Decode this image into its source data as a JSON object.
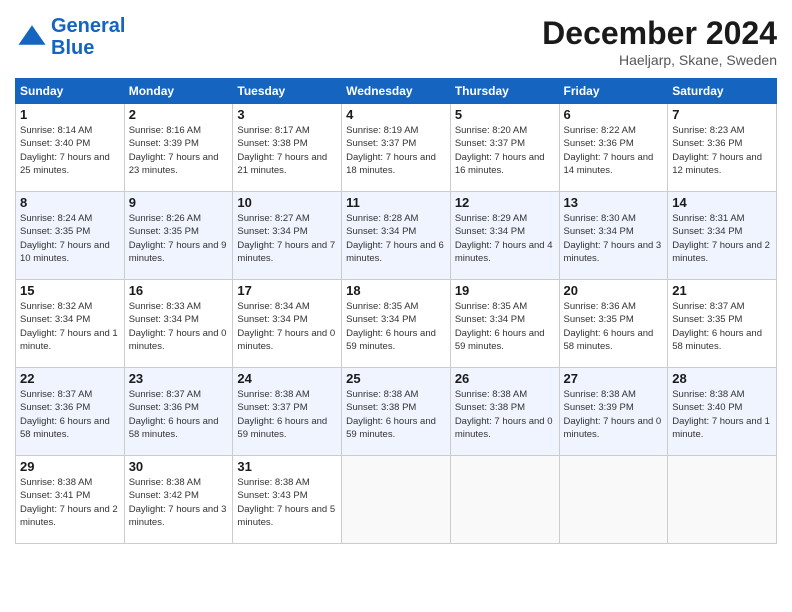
{
  "logo": {
    "line1": "General",
    "line2": "Blue"
  },
  "header": {
    "title": "December 2024",
    "location": "Haeljarp, Skane, Sweden"
  },
  "weekdays": [
    "Sunday",
    "Monday",
    "Tuesday",
    "Wednesday",
    "Thursday",
    "Friday",
    "Saturday"
  ],
  "weeks": [
    [
      {
        "day": "1",
        "sunrise": "8:14 AM",
        "sunset": "3:40 PM",
        "daylight": "7 hours and 25 minutes."
      },
      {
        "day": "2",
        "sunrise": "8:16 AM",
        "sunset": "3:39 PM",
        "daylight": "7 hours and 23 minutes."
      },
      {
        "day": "3",
        "sunrise": "8:17 AM",
        "sunset": "3:38 PM",
        "daylight": "7 hours and 21 minutes."
      },
      {
        "day": "4",
        "sunrise": "8:19 AM",
        "sunset": "3:37 PM",
        "daylight": "7 hours and 18 minutes."
      },
      {
        "day": "5",
        "sunrise": "8:20 AM",
        "sunset": "3:37 PM",
        "daylight": "7 hours and 16 minutes."
      },
      {
        "day": "6",
        "sunrise": "8:22 AM",
        "sunset": "3:36 PM",
        "daylight": "7 hours and 14 minutes."
      },
      {
        "day": "7",
        "sunrise": "8:23 AM",
        "sunset": "3:36 PM",
        "daylight": "7 hours and 12 minutes."
      }
    ],
    [
      {
        "day": "8",
        "sunrise": "8:24 AM",
        "sunset": "3:35 PM",
        "daylight": "7 hours and 10 minutes."
      },
      {
        "day": "9",
        "sunrise": "8:26 AM",
        "sunset": "3:35 PM",
        "daylight": "7 hours and 9 minutes."
      },
      {
        "day": "10",
        "sunrise": "8:27 AM",
        "sunset": "3:34 PM",
        "daylight": "7 hours and 7 minutes."
      },
      {
        "day": "11",
        "sunrise": "8:28 AM",
        "sunset": "3:34 PM",
        "daylight": "7 hours and 6 minutes."
      },
      {
        "day": "12",
        "sunrise": "8:29 AM",
        "sunset": "3:34 PM",
        "daylight": "7 hours and 4 minutes."
      },
      {
        "day": "13",
        "sunrise": "8:30 AM",
        "sunset": "3:34 PM",
        "daylight": "7 hours and 3 minutes."
      },
      {
        "day": "14",
        "sunrise": "8:31 AM",
        "sunset": "3:34 PM",
        "daylight": "7 hours and 2 minutes."
      }
    ],
    [
      {
        "day": "15",
        "sunrise": "8:32 AM",
        "sunset": "3:34 PM",
        "daylight": "7 hours and 1 minute."
      },
      {
        "day": "16",
        "sunrise": "8:33 AM",
        "sunset": "3:34 PM",
        "daylight": "7 hours and 0 minutes."
      },
      {
        "day": "17",
        "sunrise": "8:34 AM",
        "sunset": "3:34 PM",
        "daylight": "7 hours and 0 minutes."
      },
      {
        "day": "18",
        "sunrise": "8:35 AM",
        "sunset": "3:34 PM",
        "daylight": "6 hours and 59 minutes."
      },
      {
        "day": "19",
        "sunrise": "8:35 AM",
        "sunset": "3:34 PM",
        "daylight": "6 hours and 59 minutes."
      },
      {
        "day": "20",
        "sunrise": "8:36 AM",
        "sunset": "3:35 PM",
        "daylight": "6 hours and 58 minutes."
      },
      {
        "day": "21",
        "sunrise": "8:37 AM",
        "sunset": "3:35 PM",
        "daylight": "6 hours and 58 minutes."
      }
    ],
    [
      {
        "day": "22",
        "sunrise": "8:37 AM",
        "sunset": "3:36 PM",
        "daylight": "6 hours and 58 minutes."
      },
      {
        "day": "23",
        "sunrise": "8:37 AM",
        "sunset": "3:36 PM",
        "daylight": "6 hours and 58 minutes."
      },
      {
        "day": "24",
        "sunrise": "8:38 AM",
        "sunset": "3:37 PM",
        "daylight": "6 hours and 59 minutes."
      },
      {
        "day": "25",
        "sunrise": "8:38 AM",
        "sunset": "3:38 PM",
        "daylight": "6 hours and 59 minutes."
      },
      {
        "day": "26",
        "sunrise": "8:38 AM",
        "sunset": "3:38 PM",
        "daylight": "7 hours and 0 minutes."
      },
      {
        "day": "27",
        "sunrise": "8:38 AM",
        "sunset": "3:39 PM",
        "daylight": "7 hours and 0 minutes."
      },
      {
        "day": "28",
        "sunrise": "8:38 AM",
        "sunset": "3:40 PM",
        "daylight": "7 hours and 1 minute."
      }
    ],
    [
      {
        "day": "29",
        "sunrise": "8:38 AM",
        "sunset": "3:41 PM",
        "daylight": "7 hours and 2 minutes."
      },
      {
        "day": "30",
        "sunrise": "8:38 AM",
        "sunset": "3:42 PM",
        "daylight": "7 hours and 3 minutes."
      },
      {
        "day": "31",
        "sunrise": "8:38 AM",
        "sunset": "3:43 PM",
        "daylight": "7 hours and 5 minutes."
      },
      null,
      null,
      null,
      null
    ]
  ],
  "labels": {
    "sunrise": "Sunrise:",
    "sunset": "Sunset:",
    "daylight": "Daylight:"
  }
}
